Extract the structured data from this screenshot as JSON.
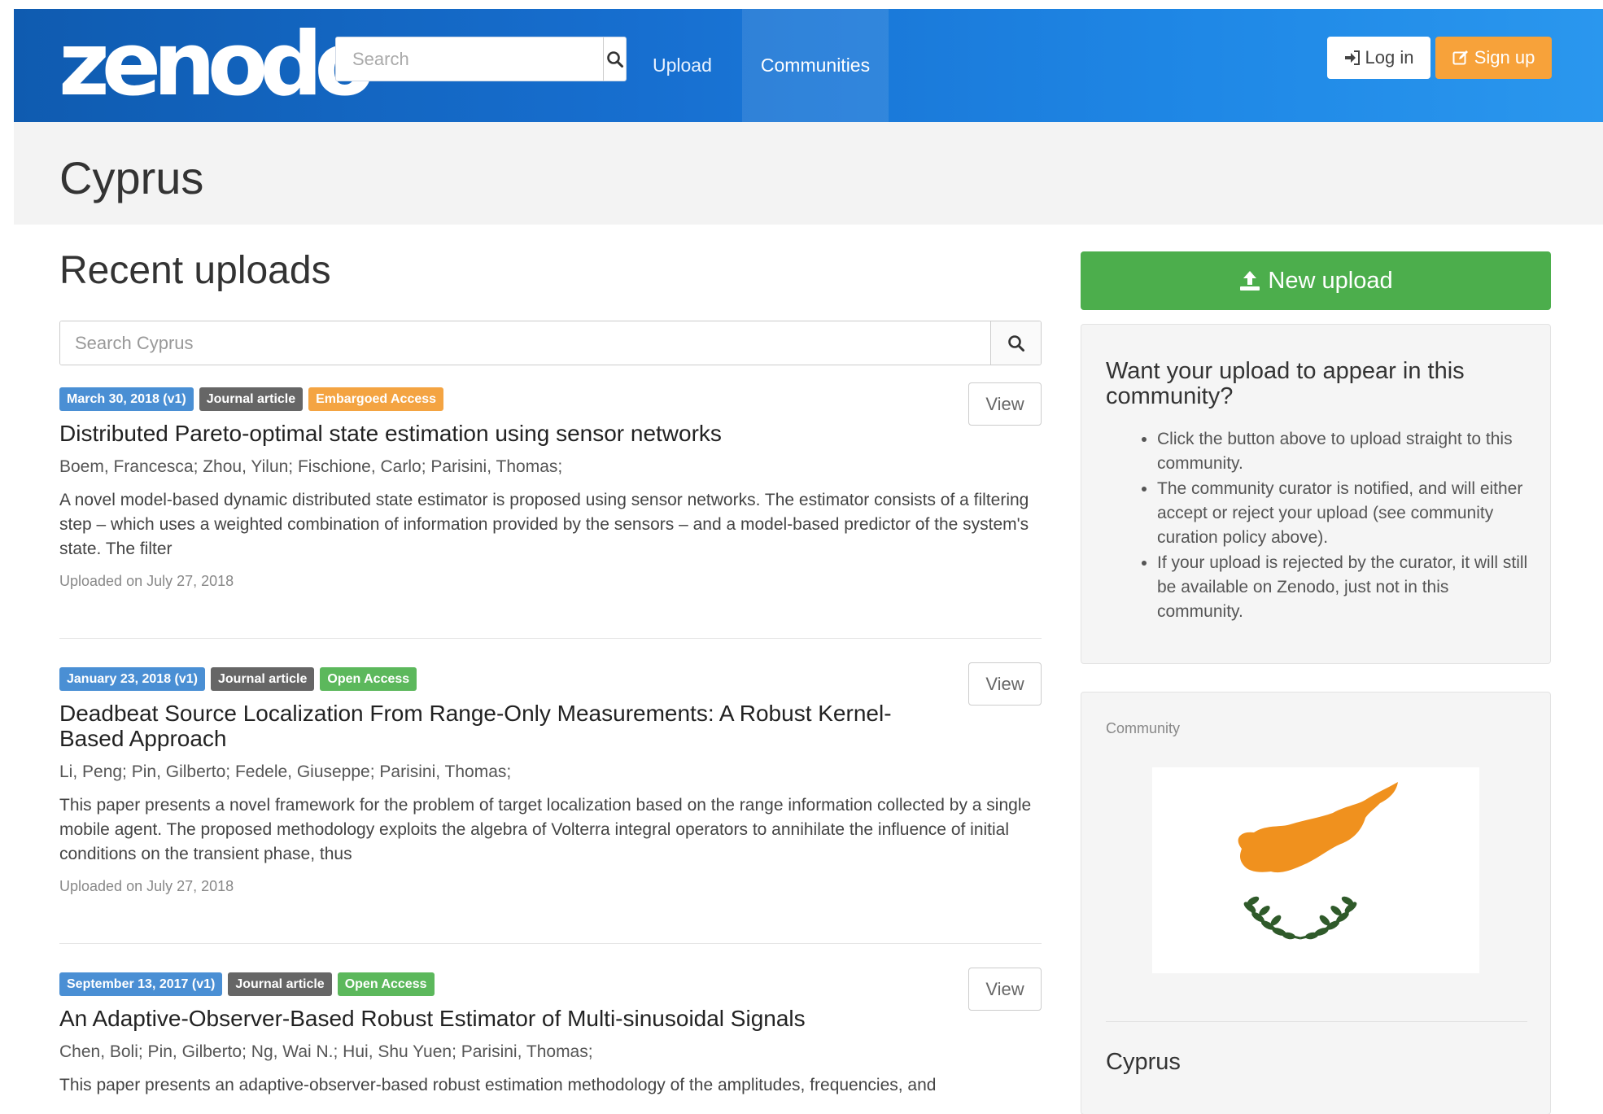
{
  "navbar": {
    "logo": "zenodo",
    "search_placeholder": "Search",
    "upload_label": "Upload",
    "communities_label": "Communities",
    "login_label": "Log in",
    "signup_label": "Sign up"
  },
  "community": {
    "title": "Cyprus"
  },
  "main": {
    "recent_heading": "Recent uploads",
    "search_placeholder": "Search Cyprus",
    "view_label": "View",
    "records": [
      {
        "date_badge": "March 30, 2018 (v1)",
        "type_badge": "Journal article",
        "access_badge": "Embargoed Access",
        "title": "Distributed Pareto-optimal state estimation using sensor networks",
        "authors": "Boem, Francesca; Zhou, Yilun; Fischione, Carlo; Parisini, Thomas;",
        "description": "A novel model-based dynamic distributed state estimator is proposed using sensor networks. The estimator consists of a filtering step – which uses a weighted combination of information provided by the sensors – and a model-based predictor of the system's state. The filter",
        "uploaded": "Uploaded on July 27, 2018"
      },
      {
        "date_badge": "January 23, 2018 (v1)",
        "type_badge": "Journal article",
        "access_badge": "Open Access",
        "title": "Deadbeat Source Localization From Range-Only Measurements: A Robust Kernel-Based Approach",
        "authors": "Li, Peng; Pin, Gilberto; Fedele, Giuseppe; Parisini, Thomas;",
        "description": "This paper presents a novel framework for the problem of target localization based on the range information collected by a single mobile agent. The proposed methodology exploits the algebra of Volterra integral operators to annihilate the influence of initial conditions on the transient phase, thus",
        "uploaded": "Uploaded on July 27, 2018"
      },
      {
        "date_badge": "September 13, 2017 (v1)",
        "type_badge": "Journal article",
        "access_badge": "Open Access",
        "title": "An Adaptive-Observer-Based Robust Estimator of Multi-sinusoidal Signals",
        "authors": "Chen, Boli; Pin, Gilberto; Ng, Wai N.; Hui, Shu Yuen; Parisini, Thomas;",
        "description": "This paper presents an adaptive-observer-based robust estimation methodology of the amplitudes, frequencies, and",
        "uploaded": ""
      }
    ]
  },
  "sidebar": {
    "new_upload_label": "New upload",
    "info_title": "Want your upload to appear in this community?",
    "info_items": [
      "Click the button above to upload straight to this community.",
      "The community curator is notified, and will either accept or reject your upload (see community curation policy above).",
      "If your upload is rejected by the curator, it will still be available on Zenodo, just not in this community."
    ],
    "community_label": "Community",
    "community_name": "Cyprus",
    "flag_icon": "cyprus-flag-icon"
  },
  "colors": {
    "navbar_start": "#0f5bb0",
    "navbar_end": "#2a97ee",
    "signup": "#f7a23a",
    "new_upload": "#4cae4c",
    "badge_date": "#4a8fd4",
    "badge_type": "#666666",
    "badge_embargo": "#f4a442",
    "badge_open": "#5cb85c",
    "flag_map": "#f0911e",
    "flag_branches": "#2f5a2a"
  }
}
